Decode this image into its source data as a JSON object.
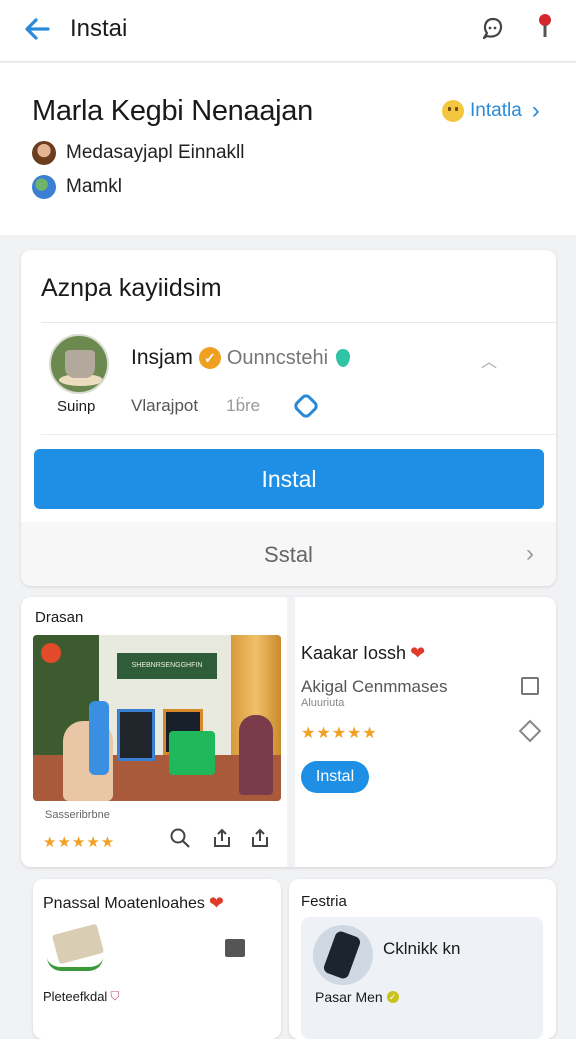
{
  "topbar": {
    "title": "Instai"
  },
  "header": {
    "title": "Marla Kegbi Nenaajan",
    "action_label": "Intatla",
    "meta_line1": "Medasayjapl Einnakll",
    "meta_line2": "Mamkl"
  },
  "app_card": {
    "title": "Aznpa kayiidsim",
    "app_name": "Insjam",
    "developer": "Ounncstehi",
    "icon_caption": "Suinp",
    "info_label": "Vlarajpot",
    "info_value": "1b̈re",
    "install_label": "Instal",
    "secondary_label": "Sstal"
  },
  "featured": {
    "section_title": "Drasan",
    "promo_banner": "SHEBNRSENGGHFIN",
    "promo_caption": "Sasseribrbne",
    "promo_stars": "★★★★★",
    "item_title": "Kaakar Iossh",
    "item_line1": "Akigal Cenmmases",
    "item_line2": "Aluuriuta",
    "item_stars": "★★★★★",
    "item_button": "Instal"
  },
  "card_left": {
    "title": "Pnassal Moatenloahes",
    "subtitle": "Pleteefkdal"
  },
  "card_right": {
    "title": "Festria",
    "product_name": "Cklnikk kn",
    "subtitle": "Pasar Men"
  }
}
